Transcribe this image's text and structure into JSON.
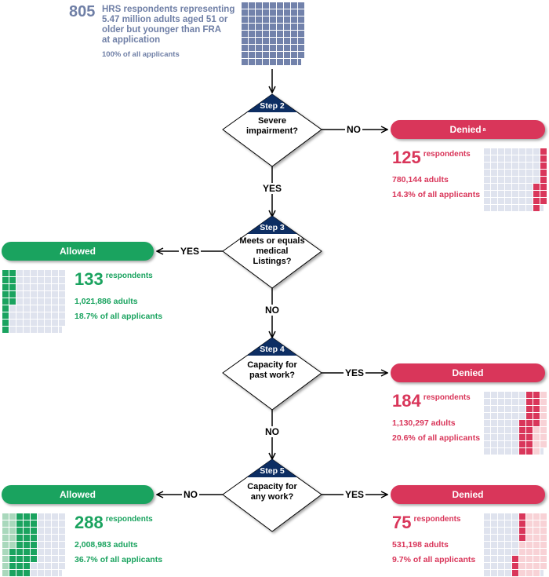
{
  "intro": {
    "count": "805",
    "description_lines": [
      "HRS respondents representing",
      "5.47 million adults aged 51 or",
      "older but younger than FRA",
      "at application"
    ],
    "share": "100% of all applicants",
    "waffle": {
      "total_respondents": 805,
      "respondents_per_cell": 10,
      "color": "#7282ab"
    }
  },
  "steps": [
    {
      "id": "step2",
      "title": "Step 2",
      "question_lines": [
        "Severe",
        "impairment?"
      ]
    },
    {
      "id": "step3",
      "title": "Step 3",
      "question_lines": [
        "Meets or equals",
        "medical",
        "Listings?"
      ]
    },
    {
      "id": "step4",
      "title": "Step 4",
      "question_lines": [
        "Capacity for",
        "past work?"
      ]
    },
    {
      "id": "step5",
      "title": "Step 5",
      "question_lines": [
        "Capacity for",
        "any work?"
      ]
    }
  ],
  "branch_labels": {
    "step2_no": "NO",
    "step2_yes": "YES",
    "step3_yes": "YES",
    "step3_no": "NO",
    "step4_yes": "YES",
    "step4_no": "NO",
    "step5_no": "NO",
    "step5_yes": "YES"
  },
  "outcomes": [
    {
      "id": "denied-step2",
      "label": "Denied",
      "footnote": "a",
      "type": "denied",
      "respondents": "125",
      "respondents_label": "respondents",
      "adults": "780,144 adults",
      "share": "14.3% of all applicants",
      "waffle": {
        "previous_respondents": 0,
        "current_respondents": 125
      }
    },
    {
      "id": "allowed-step3",
      "label": "Allowed",
      "footnote": "",
      "type": "allowed",
      "respondents": "133",
      "respondents_label": "respondents",
      "adults": "1,021,886 adults",
      "share": "18.7% of all applicants",
      "waffle": {
        "previous_respondents": 0,
        "current_respondents": 133
      }
    },
    {
      "id": "denied-step4",
      "label": "Denied",
      "footnote": "",
      "type": "denied",
      "respondents": "184",
      "respondents_label": "respondents",
      "adults": "1,130,297 adults",
      "share": "20.6% of all applicants",
      "waffle": {
        "previous_respondents": 125,
        "current_respondents": 184
      }
    },
    {
      "id": "allowed-step5",
      "label": "Allowed",
      "footnote": "",
      "type": "allowed",
      "respondents": "288",
      "respondents_label": "respondents",
      "adults": "2,008,983 adults",
      "share": "36.7% of all applicants",
      "waffle": {
        "previous_respondents": 133,
        "current_respondents": 288
      }
    },
    {
      "id": "denied-step5",
      "label": "Denied",
      "footnote": "",
      "type": "denied",
      "respondents": "75",
      "respondents_label": "respondents",
      "adults": "531,198 adults",
      "share": "9.7% of all applicants",
      "waffle": {
        "previous_respondents": 309,
        "current_respondents": 75
      }
    }
  ],
  "colors": {
    "denied": "#d9365a",
    "denied_dark": "#d21f36",
    "denied_light": "#f8d2d6",
    "allowed": "#1aa35f",
    "allowed_light": "#a9d8bc",
    "empty": "#dfe3ee",
    "step_header": "#0d2f63",
    "slate": "#7282ab"
  }
}
